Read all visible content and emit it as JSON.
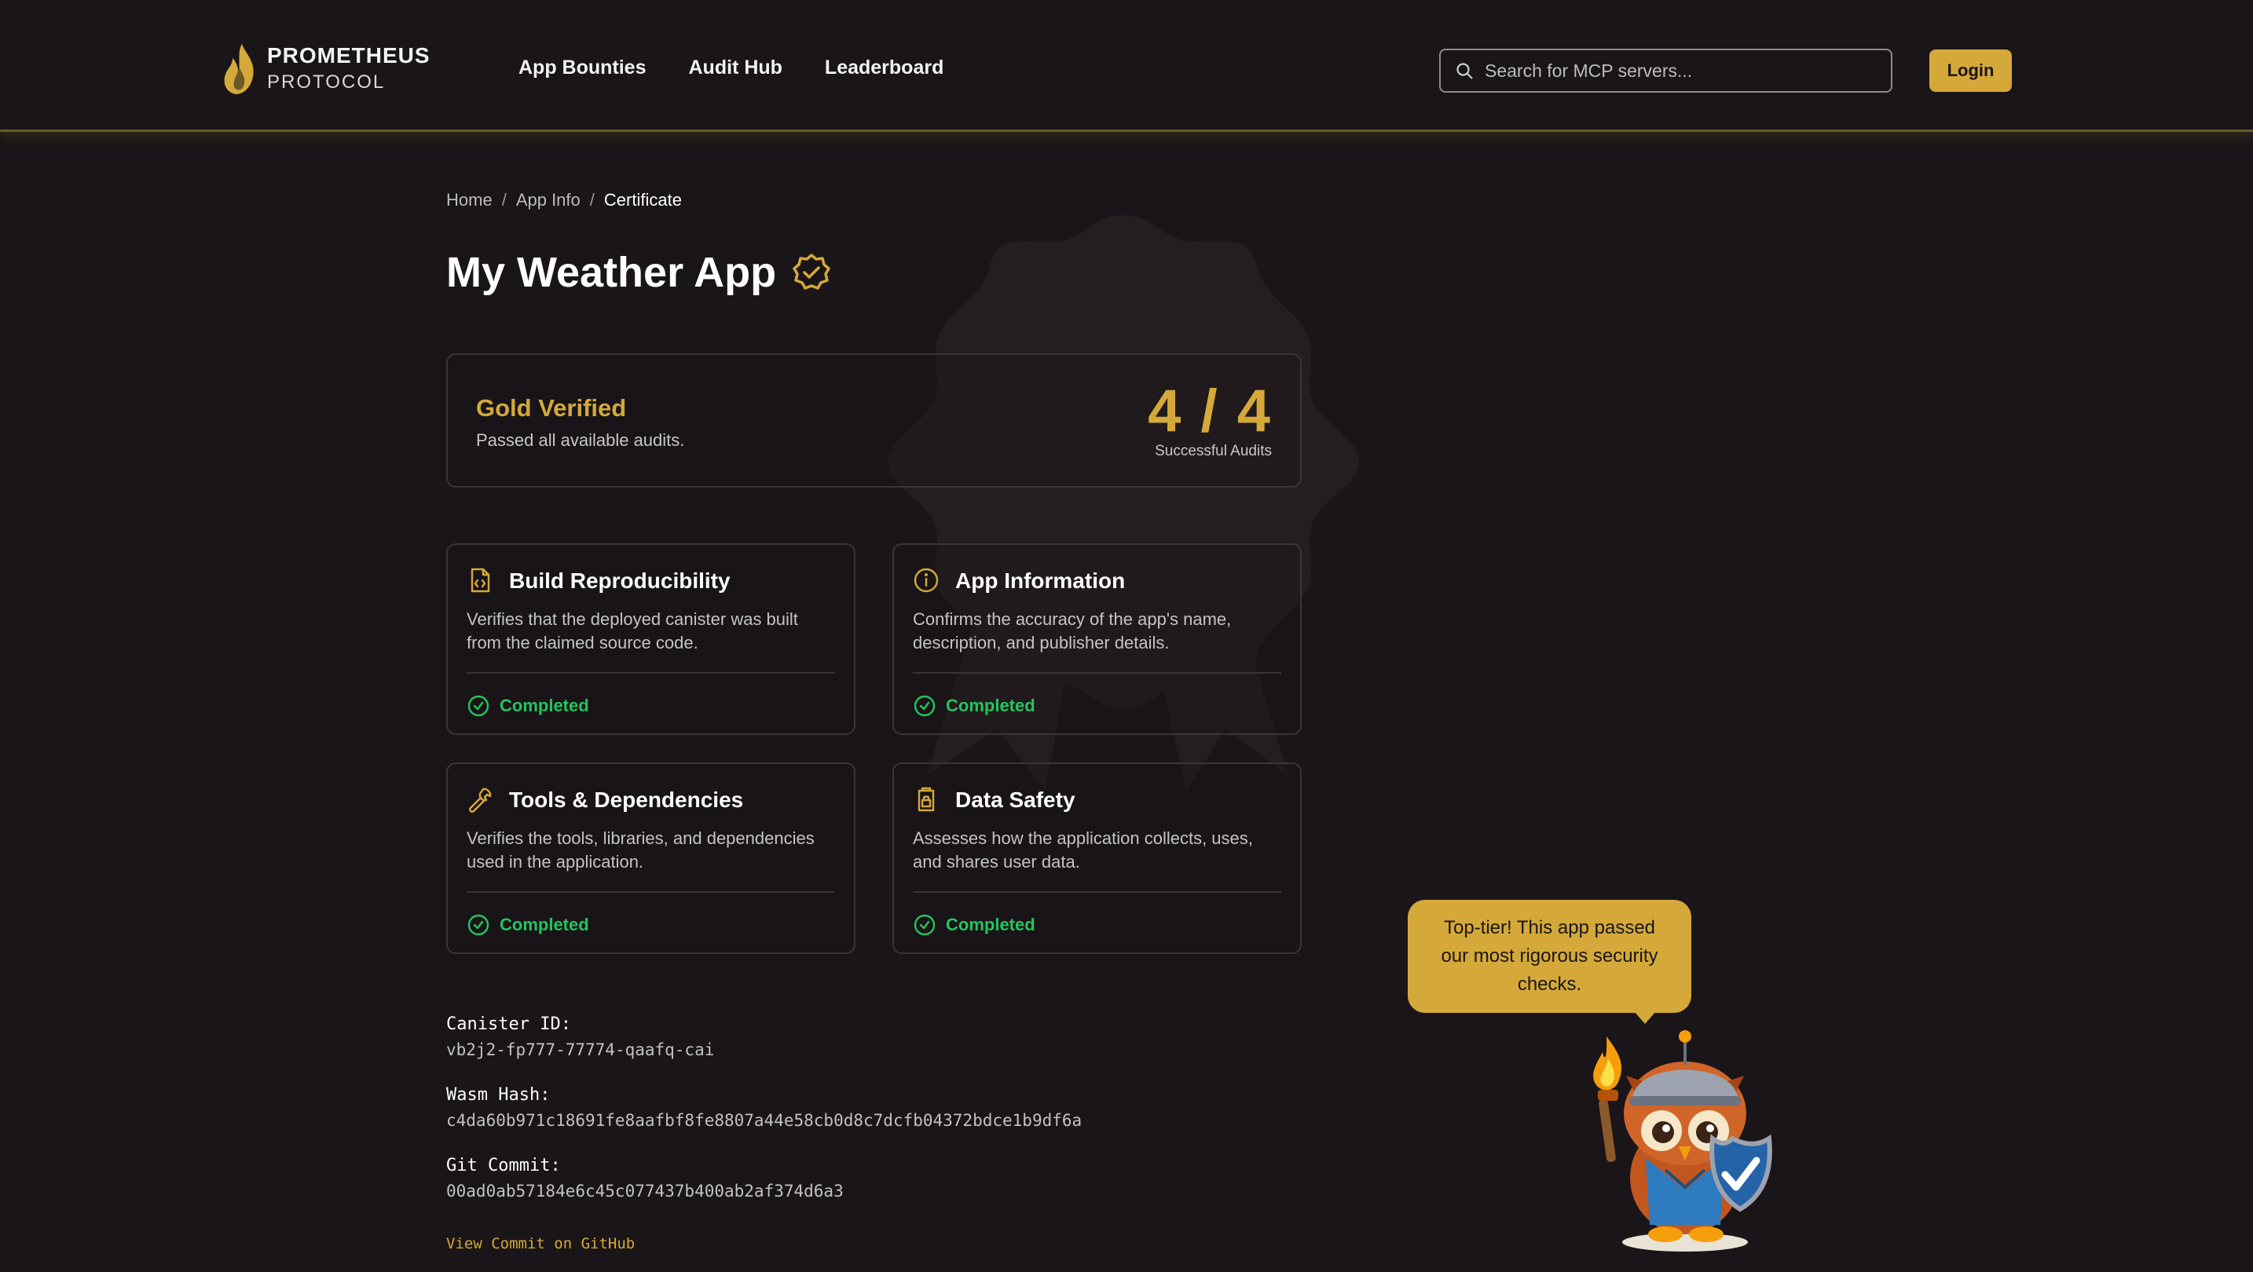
{
  "header": {
    "brand_line1": "PROMETHEUS",
    "brand_line2": "PROTOCOL",
    "nav": [
      "App Bounties",
      "Audit Hub",
      "Leaderboard"
    ],
    "search_placeholder": "Search for MCP servers...",
    "login_label": "Login"
  },
  "breadcrumb": [
    "Home",
    "App Info",
    "Certificate"
  ],
  "app": {
    "name": "My Weather App"
  },
  "summary": {
    "tier": "Gold Verified",
    "description": "Passed all available audits.",
    "score": "4 / 4",
    "score_label": "Successful Audits"
  },
  "audits": [
    {
      "title": "Build Reproducibility",
      "description": "Verifies that the deployed canister was built from the claimed source code.",
      "status": "Completed",
      "icon": "file-code-icon"
    },
    {
      "title": "App Information",
      "description": "Confirms the accuracy of the app's name, description, and publisher details.",
      "status": "Completed",
      "icon": "info-icon"
    },
    {
      "title": "Tools & Dependencies",
      "description": "Verifies the tools, libraries, and dependencies used in the application.",
      "status": "Completed",
      "icon": "wrench-icon"
    },
    {
      "title": "Data Safety",
      "description": "Assesses how the application collects, uses, and shares user data.",
      "status": "Completed",
      "icon": "clipboard-lock-icon"
    }
  ],
  "meta": {
    "canister_label": "Canister ID:",
    "canister_id": "vb2j2-fp777-77774-qaafq-cai",
    "wasm_label": "Wasm Hash:",
    "wasm_hash": "c4da60b971c18691fe8aafbf8fe8807a44e58cb0d8c7dcfb04372bdce1b9df6a",
    "git_label": "Git Commit:",
    "git_commit": "00ad0ab57184e6c45c077437b400ab2af374d6a3",
    "github_link": "View Commit on GitHub"
  },
  "mascot": {
    "message": "Top-tier! This app passed our most rigorous security checks."
  },
  "colors": {
    "background": "#1a1518",
    "accent_gold": "#d4a93a",
    "success_green": "#22c55e"
  }
}
